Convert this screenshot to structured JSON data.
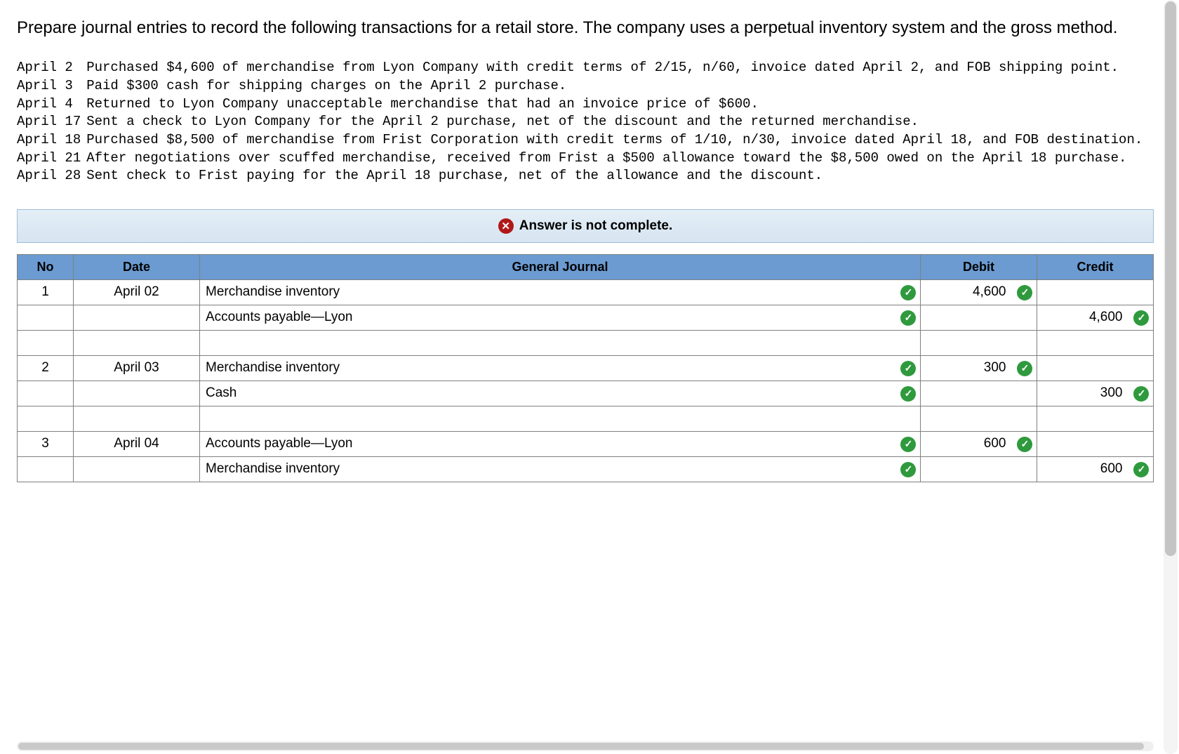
{
  "question": "Prepare journal entries to record the following transactions for a retail store. The company uses a perpetual inventory system and the gross method.",
  "transactions": [
    {
      "date": "April 2",
      "text": "Purchased $4,600 of merchandise from Lyon Company with credit terms of 2/15, n/60, invoice dated April 2, and FOB shipping point."
    },
    {
      "date": "April 3",
      "text": "Paid $300 cash for shipping charges on the April 2 purchase."
    },
    {
      "date": "April 4",
      "text": "Returned to Lyon Company unacceptable merchandise that had an invoice price of $600."
    },
    {
      "date": "April 17",
      "text": "Sent a check to Lyon Company for the April 2 purchase, net of the discount and the returned merchandise."
    },
    {
      "date": "April 18",
      "text": "Purchased $8,500 of merchandise from Frist Corporation with credit terms of 1/10, n/30, invoice dated April 18, and FOB destination."
    },
    {
      "date": "April 21",
      "text": "After negotiations over scuffed merchandise, received from Frist a $500 allowance toward the $8,500 owed on the April 18 purchase."
    },
    {
      "date": "April 28",
      "text": "Sent check to Frist paying for the April 18 purchase, net of the allowance and the discount."
    }
  ],
  "banner": "Answer is not complete.",
  "headers": {
    "no": "No",
    "date": "Date",
    "gj": "General Journal",
    "debit": "Debit",
    "credit": "Credit"
  },
  "rows": [
    {
      "no": "1",
      "date": "April 02",
      "account": "Merchandise inventory",
      "indent": false,
      "acct_ok": true,
      "debit": "4,600",
      "debit_ok": true,
      "credit": "",
      "credit_ok": false
    },
    {
      "no": "",
      "date": "",
      "account": "Accounts payable—Lyon",
      "indent": true,
      "acct_ok": true,
      "debit": "",
      "debit_ok": false,
      "credit": "4,600",
      "credit_ok": true
    },
    {
      "no": "",
      "date": "",
      "account": "",
      "indent": false,
      "acct_ok": false,
      "debit": "",
      "debit_ok": false,
      "credit": "",
      "credit_ok": false
    },
    {
      "no": "2",
      "date": "April 03",
      "account": "Merchandise inventory",
      "indent": false,
      "acct_ok": true,
      "debit": "300",
      "debit_ok": true,
      "credit": "",
      "credit_ok": false
    },
    {
      "no": "",
      "date": "",
      "account": "Cash",
      "indent": true,
      "acct_ok": true,
      "debit": "",
      "debit_ok": false,
      "credit": "300",
      "credit_ok": true
    },
    {
      "no": "",
      "date": "",
      "account": "",
      "indent": false,
      "acct_ok": false,
      "debit": "",
      "debit_ok": false,
      "credit": "",
      "credit_ok": false
    },
    {
      "no": "3",
      "date": "April 04",
      "account": "Accounts payable—Lyon",
      "indent": false,
      "acct_ok": true,
      "debit": "600",
      "debit_ok": true,
      "credit": "",
      "credit_ok": false
    },
    {
      "no": "",
      "date": "",
      "account": "Merchandise inventory",
      "indent": true,
      "acct_ok": true,
      "debit": "",
      "debit_ok": false,
      "credit": "600",
      "credit_ok": true
    }
  ]
}
